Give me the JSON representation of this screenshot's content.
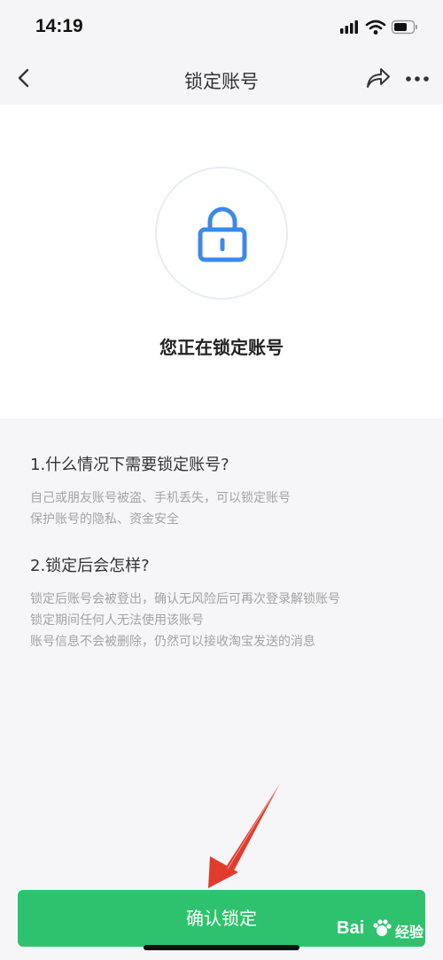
{
  "status_bar": {
    "time": "14:19"
  },
  "nav": {
    "title": "锁定账号",
    "icons": [
      "back-icon",
      "share-icon",
      "more-icon"
    ]
  },
  "hero": {
    "icon": "lock-icon",
    "text": "您正在锁定账号"
  },
  "faq": [
    {
      "question": "1.什么情况下需要锁定账号?",
      "lines": [
        "自己或朋友账号被盗、手机丢失，可以锁定账号",
        "保护账号的隐私、资金安全"
      ]
    },
    {
      "question": "2.锁定后会怎样?",
      "lines": [
        "锁定后账号会被登出，确认无风险后可再次登录解锁账号",
        "锁定期间任何人无法使用该账号",
        "账号信息不会被删除，仍然可以接收淘宝发送的消息"
      ]
    }
  ],
  "confirm_button": {
    "label": "确认锁定"
  },
  "watermark": {
    "logo": "Bai",
    "sub": "经验"
  },
  "colors": {
    "accent": "#2fc26e",
    "lock": "#3d8ae6",
    "arrow": "#e23b2e"
  }
}
